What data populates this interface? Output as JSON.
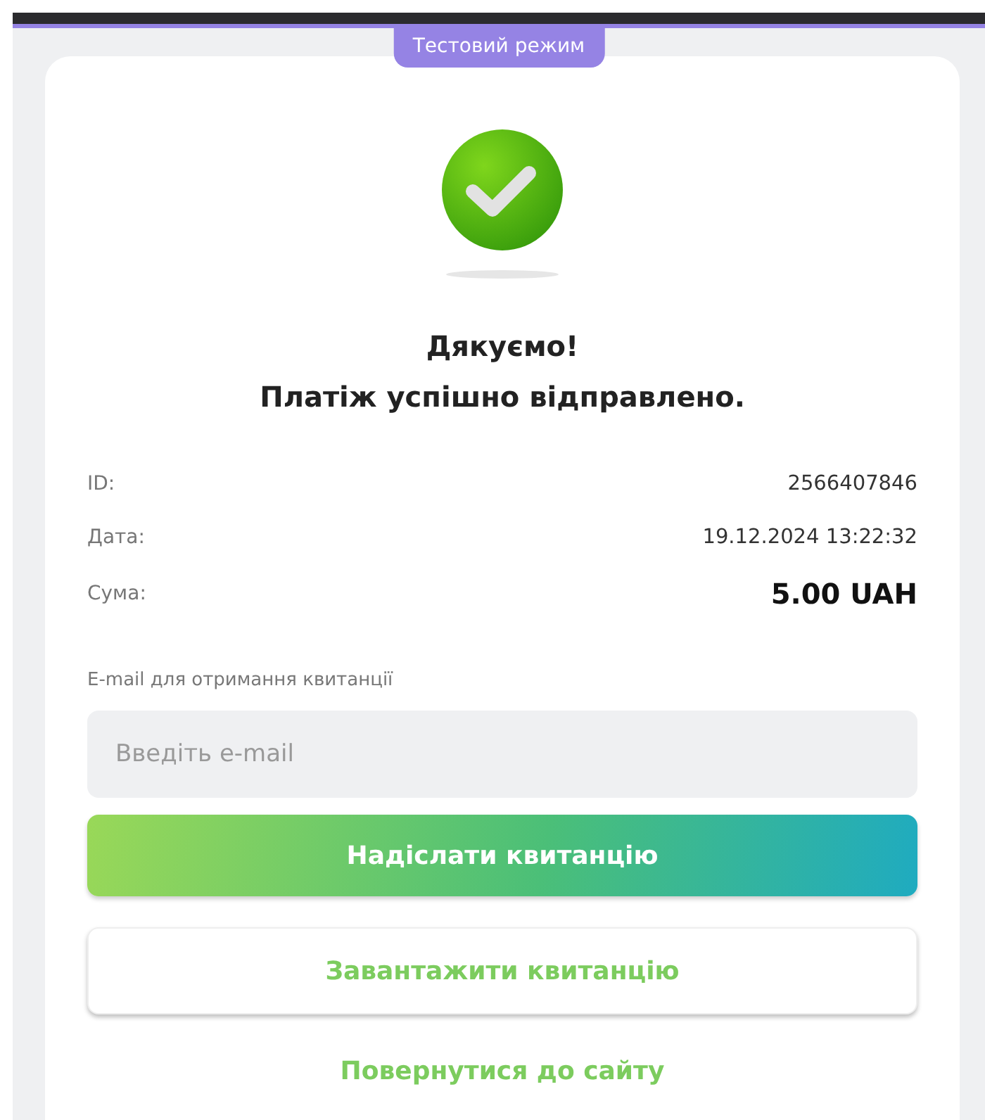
{
  "mode_badge": "Тестовий режим",
  "title": "Дякуємо!",
  "subtitle": "Платіж успішно відправлено.",
  "details": [
    {
      "label": "ID:",
      "value": "2566407846",
      "kind": "plain"
    },
    {
      "label": "Дата:",
      "value": "19.12.2024 13:22:32",
      "kind": "plain"
    },
    {
      "label": "Сума:",
      "value": "5.00 UAH",
      "kind": "amount"
    }
  ],
  "email": {
    "label": "E-mail для отримання квитанції",
    "placeholder": "Введіть e-mail"
  },
  "send_button": "Надіслати квитанцію",
  "download_button": "Завантажити квитанцію",
  "back_link": "Повернутися до сайту"
}
